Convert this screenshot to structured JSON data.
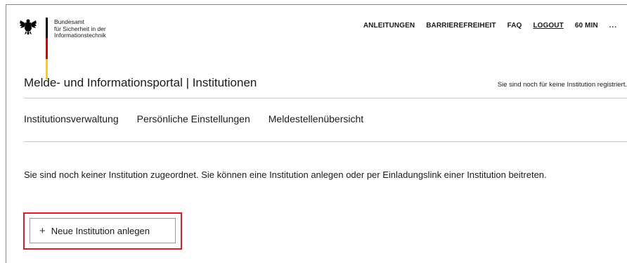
{
  "header": {
    "agency_lines": [
      "Bundesamt",
      "für Sicherheit in der",
      "Informationstechnik"
    ],
    "nav": [
      {
        "label": "ANLEITUNGEN"
      },
      {
        "label": "BARRIEREFREIHEIT"
      },
      {
        "label": "FAQ"
      },
      {
        "label": "LOGOUT"
      },
      {
        "label": "60 MIN"
      },
      {
        "label": "..."
      }
    ]
  },
  "portal": {
    "title": "Melde- und Informationsportal | Institutionen",
    "registration_status": "Sie sind noch für keine Institution registriert."
  },
  "main_nav": [
    {
      "label": "Institutionsverwaltung"
    },
    {
      "label": "Persönliche Einstellungen"
    },
    {
      "label": "Meldestellenübersicht"
    }
  ],
  "content": {
    "message": "Sie sind noch keiner Institution zugeordnet. Sie können eine Institution anlegen oder per Einladungslink einer Institution beitreten.",
    "new_button": {
      "icon": "+",
      "label": "Neue Institution anlegen"
    }
  },
  "colors": {
    "highlight": "#d81e2c",
    "flag_black": "#000000",
    "flag_red": "#dd0000",
    "flag_gold": "#ffce00"
  }
}
